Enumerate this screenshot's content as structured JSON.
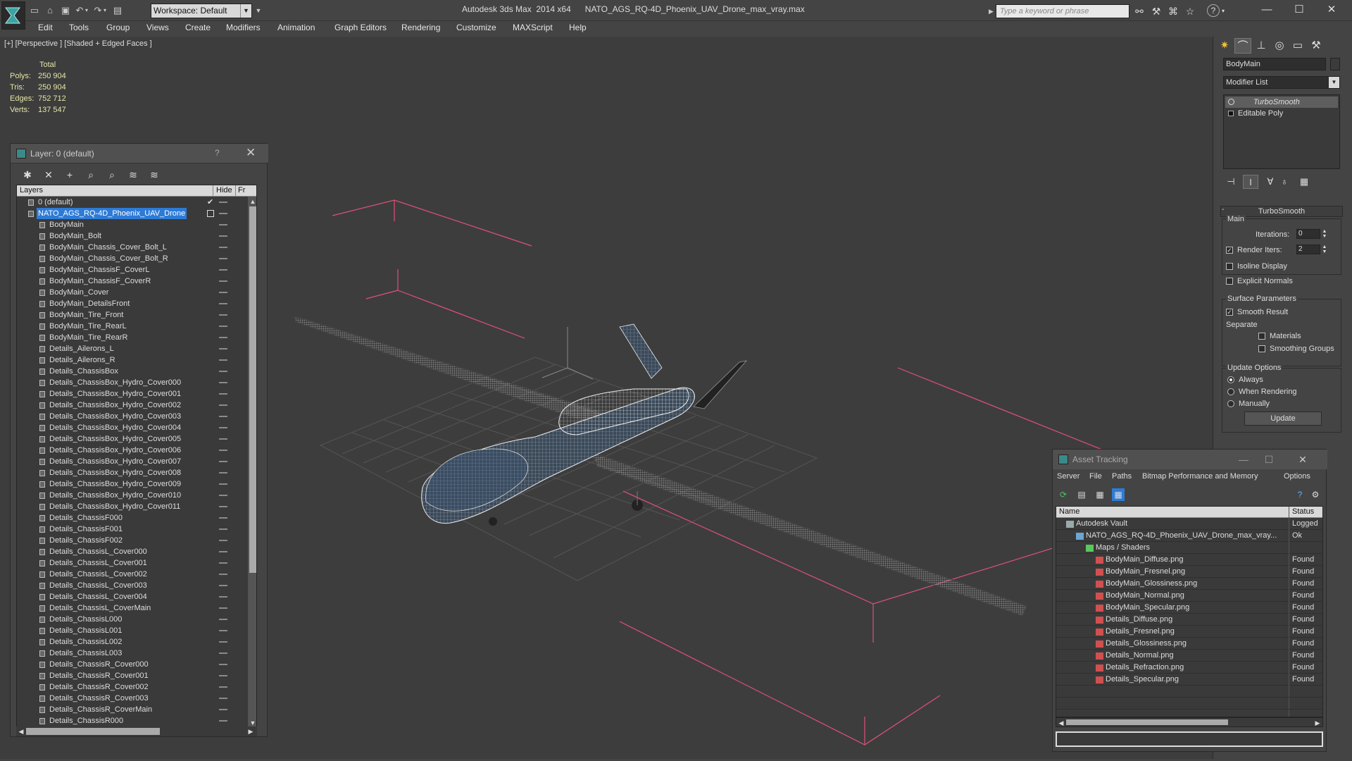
{
  "titlebar": {
    "workspace": "Workspace: Default",
    "app_title": "Autodesk 3ds Max  2014 x64",
    "file_title": "NATO_AGS_RQ-4D_Phoenix_UAV_Drone_max_vray.max",
    "search_placeholder": "Type a keyword or phrase"
  },
  "menu": [
    "Edit",
    "Tools",
    "Group",
    "Views",
    "Create",
    "Modifiers",
    "Animation",
    "Graph Editors",
    "Rendering",
    "Customize",
    "MAXScript",
    "Help"
  ],
  "viewport": {
    "label": "[+] [Perspective ] [Shaded + Edged Faces ]",
    "stats_header": "Total",
    "stats": [
      {
        "key": "Polys:",
        "value": "250 904"
      },
      {
        "key": "Tris:",
        "value": "250 904"
      },
      {
        "key": "Edges:",
        "value": "752 712"
      },
      {
        "key": "Verts:",
        "value": "137 547"
      }
    ]
  },
  "layer_panel": {
    "title": "Layer: 0 (default)",
    "help": "?",
    "col_layers": "Layers",
    "col_hide": "Hide",
    "col_fr": "Fr",
    "rows": [
      {
        "name": "0 (default)",
        "level": 1,
        "active": true
      },
      {
        "name": "NATO_AGS_RQ-4D_Phoenix_UAV_Drone",
        "level": 1,
        "selected": true
      },
      {
        "name": "BodyMain",
        "level": 2
      },
      {
        "name": "BodyMain_Bolt",
        "level": 2
      },
      {
        "name": "BodyMain_Chassis_Cover_Bolt_L",
        "level": 2
      },
      {
        "name": "BodyMain_Chassis_Cover_Bolt_R",
        "level": 2
      },
      {
        "name": "BodyMain_ChassisF_CoverL",
        "level": 2
      },
      {
        "name": "BodyMain_ChassisF_CoverR",
        "level": 2
      },
      {
        "name": "BodyMain_Cover",
        "level": 2
      },
      {
        "name": "BodyMain_DetailsFront",
        "level": 2
      },
      {
        "name": "BodyMain_Tire_Front",
        "level": 2
      },
      {
        "name": "BodyMain_Tire_RearL",
        "level": 2
      },
      {
        "name": "BodyMain_Tire_RearR",
        "level": 2
      },
      {
        "name": "Details_Ailerons_L",
        "level": 2
      },
      {
        "name": "Details_Ailerons_R",
        "level": 2
      },
      {
        "name": "Details_ChassisBox",
        "level": 2
      },
      {
        "name": "Details_ChassisBox_Hydro_Cover000",
        "level": 2
      },
      {
        "name": "Details_ChassisBox_Hydro_Cover001",
        "level": 2
      },
      {
        "name": "Details_ChassisBox_Hydro_Cover002",
        "level": 2
      },
      {
        "name": "Details_ChassisBox_Hydro_Cover003",
        "level": 2
      },
      {
        "name": "Details_ChassisBox_Hydro_Cover004",
        "level": 2
      },
      {
        "name": "Details_ChassisBox_Hydro_Cover005",
        "level": 2
      },
      {
        "name": "Details_ChassisBox_Hydro_Cover006",
        "level": 2
      },
      {
        "name": "Details_ChassisBox_Hydro_Cover007",
        "level": 2
      },
      {
        "name": "Details_ChassisBox_Hydro_Cover008",
        "level": 2
      },
      {
        "name": "Details_ChassisBox_Hydro_Cover009",
        "level": 2
      },
      {
        "name": "Details_ChassisBox_Hydro_Cover010",
        "level": 2
      },
      {
        "name": "Details_ChassisBox_Hydro_Cover011",
        "level": 2
      },
      {
        "name": "Details_ChassisF000",
        "level": 2
      },
      {
        "name": "Details_ChassisF001",
        "level": 2
      },
      {
        "name": "Details_ChassisF002",
        "level": 2
      },
      {
        "name": "Details_ChassisL_Cover000",
        "level": 2
      },
      {
        "name": "Details_ChassisL_Cover001",
        "level": 2
      },
      {
        "name": "Details_ChassisL_Cover002",
        "level": 2
      },
      {
        "name": "Details_ChassisL_Cover003",
        "level": 2
      },
      {
        "name": "Details_ChassisL_Cover004",
        "level": 2
      },
      {
        "name": "Details_ChassisL_CoverMain",
        "level": 2
      },
      {
        "name": "Details_ChassisL000",
        "level": 2
      },
      {
        "name": "Details_ChassisL001",
        "level": 2
      },
      {
        "name": "Details_ChassisL002",
        "level": 2
      },
      {
        "name": "Details_ChassisL003",
        "level": 2
      },
      {
        "name": "Details_ChassisR_Cover000",
        "level": 2
      },
      {
        "name": "Details_ChassisR_Cover001",
        "level": 2
      },
      {
        "name": "Details_ChassisR_Cover002",
        "level": 2
      },
      {
        "name": "Details_ChassisR_Cover003",
        "level": 2
      },
      {
        "name": "Details_ChassisR_CoverMain",
        "level": 2
      },
      {
        "name": "Details_ChassisR000",
        "level": 2
      }
    ]
  },
  "command_panel": {
    "object_name": "BodyMain",
    "modifier_list": "Modifier List",
    "stack": [
      {
        "name": "TurboSmooth",
        "active": true
      },
      {
        "name": "Editable Poly",
        "active": false
      }
    ],
    "rollout_title": "TurboSmooth",
    "main_label": "Main",
    "iterations_label": "Iterations:",
    "iterations_value": "0",
    "render_iters_label": "Render Iters:",
    "render_iters_value": "2",
    "render_iters_checked": true,
    "isoline_label": "Isoline Display",
    "explicit_normals_label": "Explicit Normals",
    "surface_params_label": "Surface Parameters",
    "smooth_result_label": "Smooth Result",
    "smooth_result_checked": true,
    "separate_label": "Separate",
    "materials_label": "Materials",
    "smoothing_groups_label": "Smoothing Groups",
    "update_options_label": "Update Options",
    "update_always": "Always",
    "update_when_rendering": "When Rendering",
    "update_manually": "Manually",
    "update_selected": "Always",
    "update_button": "Update"
  },
  "asset_tracking": {
    "title": "Asset Tracking",
    "menu": [
      "Server",
      "File",
      "Paths",
      "Bitmap Performance and Memory",
      "Options"
    ],
    "col_name": "Name",
    "col_status": "Status",
    "rows": [
      {
        "name": "Autodesk Vault",
        "status": "Logged",
        "level": 1,
        "kind": "vault"
      },
      {
        "name": "NATO_AGS_RQ-4D_Phoenix_UAV_Drone_max_vray...",
        "status": "Ok",
        "level": 2,
        "kind": "max"
      },
      {
        "name": "Maps / Shaders",
        "status": "",
        "level": 3,
        "kind": "folder"
      },
      {
        "name": "BodyMain_Diffuse.png",
        "status": "Found",
        "level": 4,
        "kind": "image"
      },
      {
        "name": "BodyMain_Fresnel.png",
        "status": "Found",
        "level": 4,
        "kind": "image"
      },
      {
        "name": "BodyMain_Glossiness.png",
        "status": "Found",
        "level": 4,
        "kind": "image"
      },
      {
        "name": "BodyMain_Normal.png",
        "status": "Found",
        "level": 4,
        "kind": "image"
      },
      {
        "name": "BodyMain_Specular.png",
        "status": "Found",
        "level": 4,
        "kind": "image"
      },
      {
        "name": "Details_Diffuse.png",
        "status": "Found",
        "level": 4,
        "kind": "image"
      },
      {
        "name": "Details_Fresnel.png",
        "status": "Found",
        "level": 4,
        "kind": "image"
      },
      {
        "name": "Details_Glossiness.png",
        "status": "Found",
        "level": 4,
        "kind": "image"
      },
      {
        "name": "Details_Normal.png",
        "status": "Found",
        "level": 4,
        "kind": "image"
      },
      {
        "name": "Details_Refraction.png",
        "status": "Found",
        "level": 4,
        "kind": "image"
      },
      {
        "name": "Details_Specular.png",
        "status": "Found",
        "level": 4,
        "kind": "image"
      }
    ]
  },
  "colors": {
    "accent": "#2e7bd6",
    "viewport_bg": "#3d3d3d",
    "stats_text": "#e6e6a8",
    "bounding_box": "#e0507a"
  }
}
